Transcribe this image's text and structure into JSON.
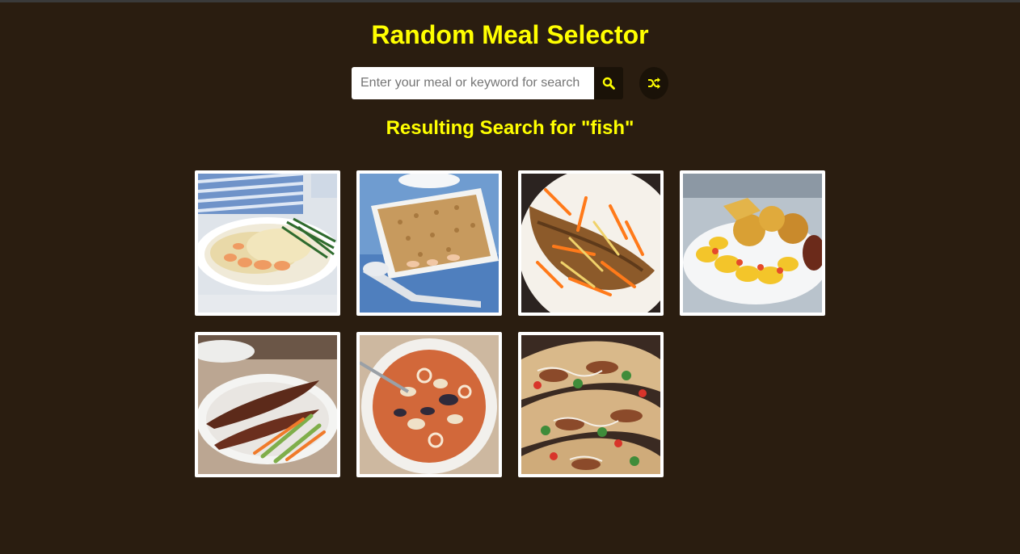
{
  "header": {
    "title": "Random Meal Selector"
  },
  "search": {
    "placeholder": "Enter your meal or keyword for search",
    "value": "",
    "search_icon": "search-icon",
    "random_icon": "shuffle-icon"
  },
  "results": {
    "heading": "Resulting Search for \"fish\"",
    "meals": [
      {
        "name": "meal-fish-pie"
      },
      {
        "name": "meal-seafood-crumble"
      },
      {
        "name": "meal-fried-fish-escovitch"
      },
      {
        "name": "meal-ackee-saltfish"
      },
      {
        "name": "meal-grilled-mackerel"
      },
      {
        "name": "meal-seafood-stew"
      },
      {
        "name": "meal-fish-tacos"
      }
    ]
  },
  "colors": {
    "background": "#2a1d10",
    "accent": "#ffff00",
    "button_bg": "#1a1208",
    "card_border": "#ffffff"
  }
}
